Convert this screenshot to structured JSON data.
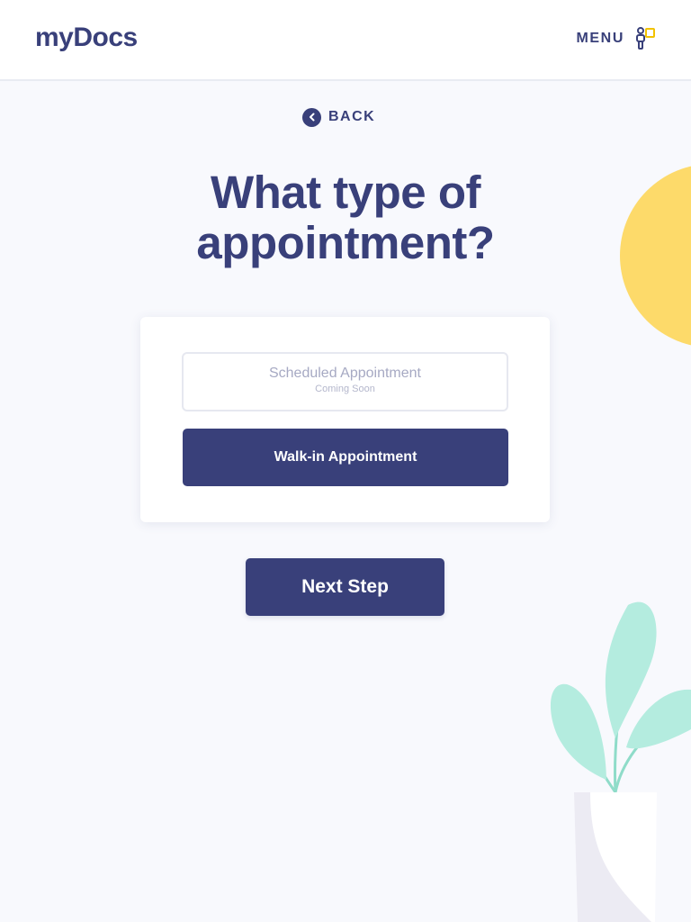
{
  "header": {
    "logo_text": "myDocs",
    "menu_label": "MENU",
    "menu_icon": "person-chat-icon"
  },
  "nav": {
    "back_label": "BACK",
    "back_icon": "chevron-left-icon"
  },
  "main": {
    "title_line1": "What type of",
    "title_line2": "appointment?",
    "options": [
      {
        "label": "Scheduled Appointment",
        "sublabel": "Coming Soon",
        "state": "disabled"
      },
      {
        "label": "Walk-in Appointment",
        "state": "selected"
      }
    ],
    "next_button_label": "Next Step"
  },
  "colors": {
    "primary": "#39407a",
    "background": "#f8f9fd",
    "accent_yellow": "#fdda6a",
    "leaf_mint": "#b4ecdf",
    "disabled_text": "#a6a9c3"
  }
}
